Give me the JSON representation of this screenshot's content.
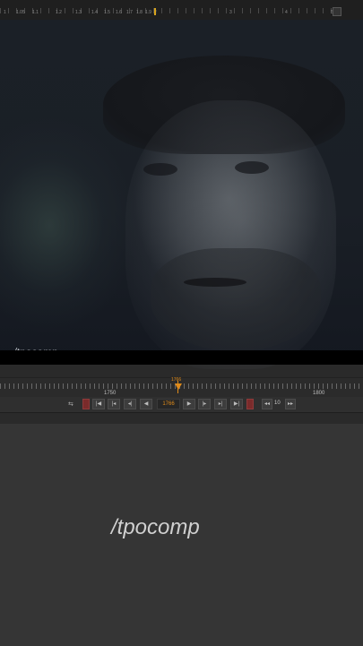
{
  "top_ruler": {
    "labels": [
      "1",
      "1.05",
      "1.1",
      "1.2",
      "1.3",
      "1.4",
      "1.5",
      "1.6",
      "1.7",
      "1.8",
      "1.9",
      "2",
      "3",
      "4",
      "5"
    ]
  },
  "viewer": {
    "watermark": "/tpocomp"
  },
  "timeline": {
    "left_label": "1750",
    "right_label": "1800",
    "current_frame_label": "1766"
  },
  "transport": {
    "current_frame": "1766",
    "step_value": "10",
    "buttons": [
      "first-frame",
      "prev-keyframe",
      "step-back",
      "play-back",
      "play-forward",
      "step-forward",
      "next-keyframe",
      "last-frame",
      "step-back-increment",
      "step-forward-increment"
    ]
  },
  "lower_panel": {
    "watermark": "/tpocomp"
  },
  "colors": {
    "accent": "#e08b1a",
    "marker": "#d8a41d"
  }
}
